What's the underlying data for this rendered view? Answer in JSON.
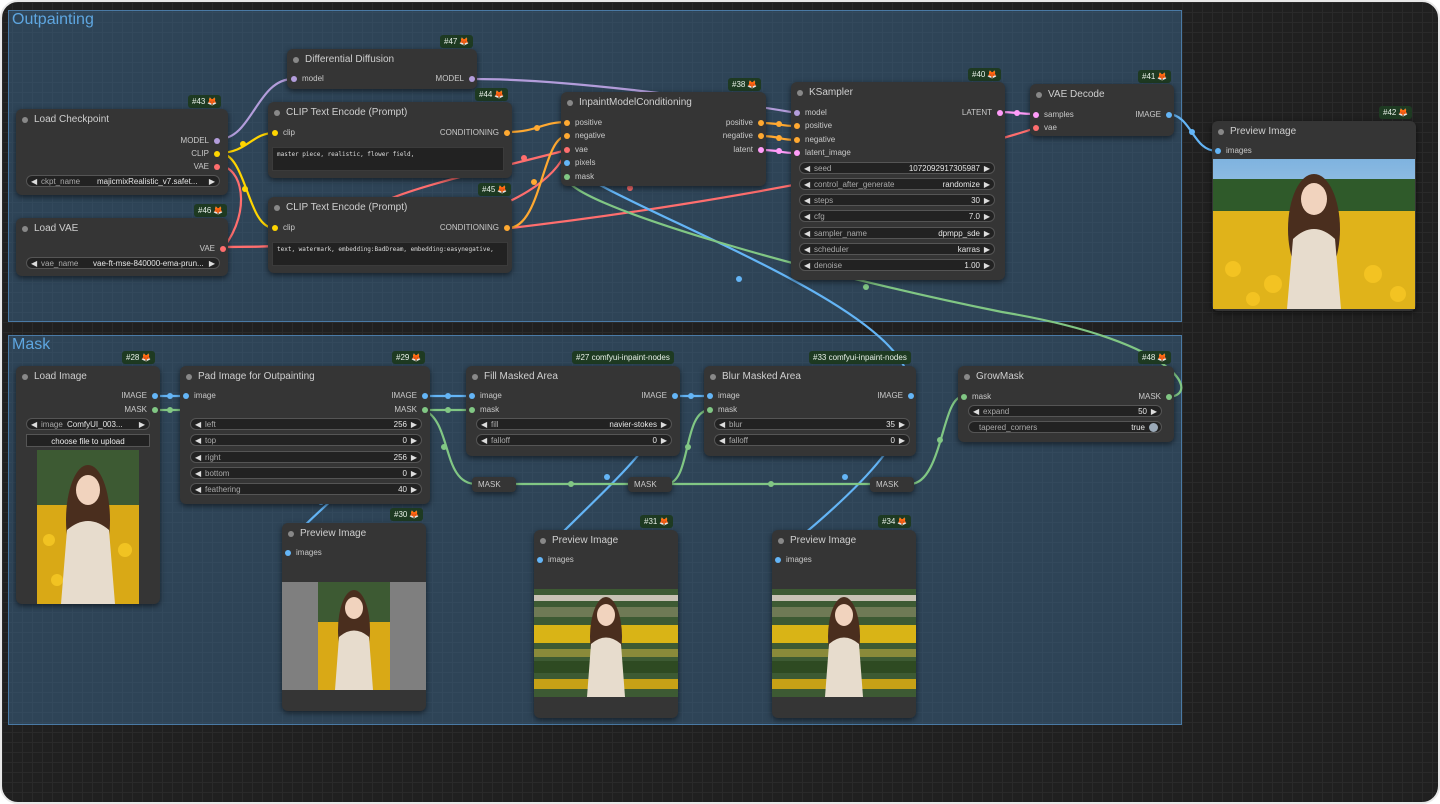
{
  "groups": {
    "outpainting": "Outpainting",
    "mask": "Mask"
  },
  "colors": {
    "model": "#b39ddb",
    "clip": "#ffd500",
    "vae": "#ff6e6e",
    "conditioning": "#ffa931",
    "latent": "#ff9cf9",
    "image": "#64b5f6",
    "mask": "#81c784",
    "badge_bg": "#1e3a22",
    "group_title": "#5ea6e0"
  },
  "nodes": {
    "load_checkpoint": {
      "badge": "#43",
      "title": "Load Checkpoint",
      "out_model": "MODEL",
      "out_clip": "CLIP",
      "out_vae": "VAE",
      "w_label": "ckpt_name",
      "w_value": "majicmixRealistic_v7.safet..."
    },
    "load_vae": {
      "badge": "#46",
      "title": "Load VAE",
      "out_vae": "VAE",
      "w_label": "vae_name",
      "w_value": "vae-ft-mse-840000-ema-prun..."
    },
    "diff_diffusion": {
      "badge": "#47",
      "title": "Differential Diffusion",
      "in_model": "model",
      "out_model": "MODEL"
    },
    "clip_pos": {
      "badge": "#44",
      "title": "CLIP Text Encode (Prompt)",
      "in_clip": "clip",
      "out": "CONDITIONING",
      "text": "master piece, realistic, flower field,"
    },
    "clip_neg": {
      "badge": "#45",
      "title": "CLIP Text Encode (Prompt)",
      "in_clip": "clip",
      "out": "CONDITIONING",
      "text": "text, watermark, embedding:BadDream, embedding:easynegative,"
    },
    "inpaint_cond": {
      "badge": "#38",
      "title": "InpaintModelConditioning",
      "in_positive": "positive",
      "in_negative": "negative",
      "in_vae": "vae",
      "in_pixels": "pixels",
      "in_mask": "mask",
      "out_positive": "positive",
      "out_negative": "negative",
      "out_latent": "latent"
    },
    "ksampler": {
      "badge": "#40",
      "title": "KSampler",
      "in_model": "model",
      "in_positive": "positive",
      "in_negative": "negative",
      "in_latent": "latent_image",
      "out_latent": "LATENT",
      "widgets": [
        {
          "label": "seed",
          "value": "1072092917305987"
        },
        {
          "label": "control_after_generate",
          "value": "randomize"
        },
        {
          "label": "steps",
          "value": "30"
        },
        {
          "label": "cfg",
          "value": "7.0"
        },
        {
          "label": "sampler_name",
          "value": "dpmpp_sde"
        },
        {
          "label": "scheduler",
          "value": "karras"
        },
        {
          "label": "denoise",
          "value": "1.00"
        }
      ]
    },
    "vae_decode": {
      "badge": "#41",
      "title": "VAE Decode",
      "in_samples": "samples",
      "in_vae": "vae",
      "out_image": "IMAGE"
    },
    "preview_42": {
      "badge": "#42",
      "title": "Preview Image",
      "in_images": "images"
    },
    "load_image": {
      "badge": "#28",
      "title": "Load Image",
      "out_image": "IMAGE",
      "out_mask": "MASK",
      "w_label": "image",
      "w_value": "ComfyUI_003...",
      "upload": "choose file to upload"
    },
    "pad_image": {
      "badge": "#29",
      "title": "Pad Image for Outpainting",
      "in_image": "image",
      "out_image": "IMAGE",
      "out_mask": "MASK",
      "widgets": [
        {
          "label": "left",
          "value": "256"
        },
        {
          "label": "top",
          "value": "0"
        },
        {
          "label": "right",
          "value": "256"
        },
        {
          "label": "bottom",
          "value": "0"
        },
        {
          "label": "feathering",
          "value": "40"
        }
      ]
    },
    "fill_masked": {
      "badge": "#27 comfyui-inpaint-nodes",
      "title": "Fill Masked Area",
      "in_image": "image",
      "in_mask": "mask",
      "out_image": "IMAGE",
      "widgets": [
        {
          "label": "fill",
          "value": "navier-stokes"
        },
        {
          "label": "falloff",
          "value": "0"
        }
      ]
    },
    "blur_masked": {
      "badge": "#33 comfyui-inpaint-nodes",
      "title": "Blur Masked Area",
      "in_image": "image",
      "in_mask": "mask",
      "out_image": "IMAGE",
      "widgets": [
        {
          "label": "blur",
          "value": "35"
        },
        {
          "label": "falloff",
          "value": "0"
        }
      ]
    },
    "grow_mask": {
      "badge": "#48",
      "title": "GrowMask",
      "in_mask": "mask",
      "out_mask": "MASK",
      "w_expand_label": "expand",
      "w_expand_value": "50",
      "w_taper_label": "tapered_corners",
      "w_taper_value": "true"
    },
    "preview_30": {
      "badge": "#30",
      "title": "Preview Image",
      "in_images": "images"
    },
    "preview_31": {
      "badge": "#31",
      "title": "Preview Image",
      "in_images": "images"
    },
    "preview_34": {
      "badge": "#34",
      "title": "Preview Image",
      "in_images": "images"
    },
    "reroute_1": {
      "label": "MASK"
    },
    "reroute_2": {
      "label": "MASK"
    },
    "reroute_3": {
      "label": "MASK"
    }
  }
}
